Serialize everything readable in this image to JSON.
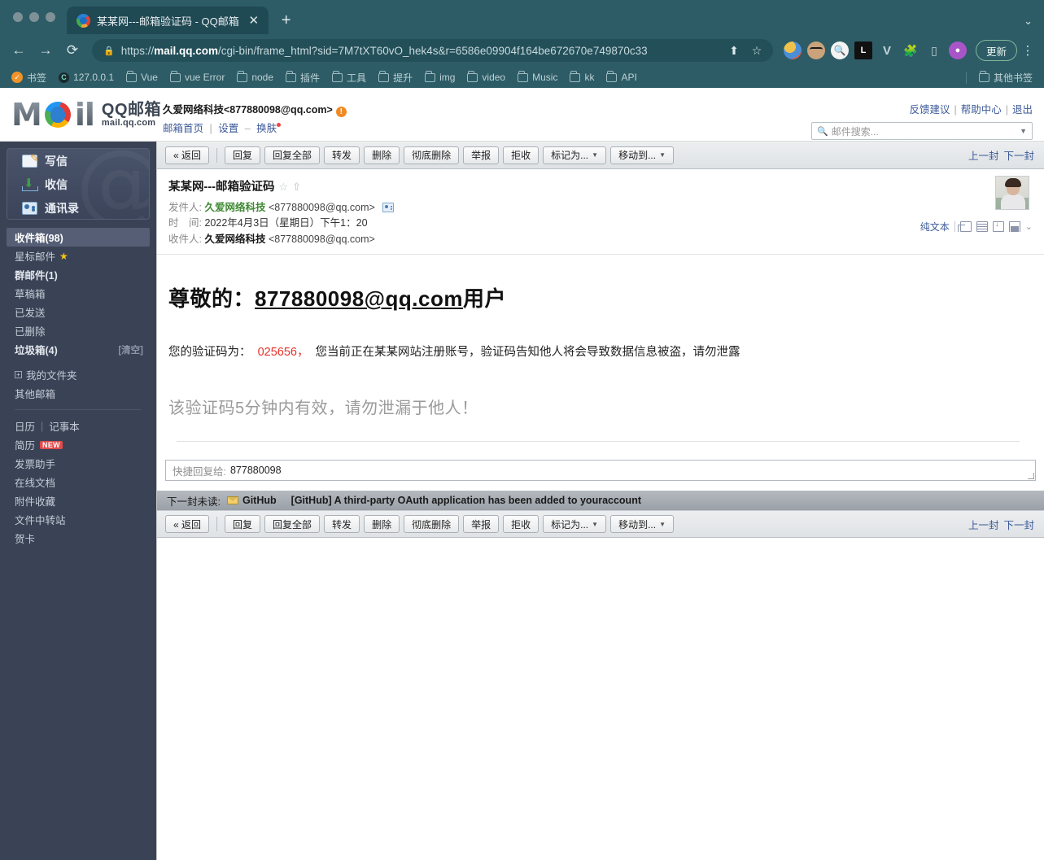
{
  "browser": {
    "tab": {
      "title": "某某网---邮箱验证码 - QQ邮箱",
      "close": "✕"
    },
    "newtab": "+",
    "window_chevron": "⌄",
    "nav": {
      "back": "←",
      "forward": "→",
      "reload": "⟳"
    },
    "omnibox": {
      "lock": "🔒",
      "url_prefix": "https://",
      "url_host": "mail.qq.com",
      "url_path": "/cgi-bin/frame_html?sid=7M7tXT60vO_hek4s&r=6586e09904f164be672670e749870c33",
      "share_icon": "⬆",
      "bookmark_icon": "☆"
    },
    "extensions": [
      "ext-a",
      "ext-b",
      "ext-c",
      "ext-d",
      "ext-e",
      "ext-f",
      "ext-g",
      "ext-h"
    ],
    "update_label": "更新",
    "menu": "⋮",
    "bookmarks": [
      {
        "label": "书签",
        "icon": "star-badge"
      },
      {
        "label": "127.0.0.1",
        "icon": "circle-c"
      },
      {
        "label": "Vue",
        "icon": "folder"
      },
      {
        "label": "vue Error",
        "icon": "folder"
      },
      {
        "label": "node",
        "icon": "folder"
      },
      {
        "label": "插件",
        "icon": "folder"
      },
      {
        "label": "工具",
        "icon": "folder"
      },
      {
        "label": "提升",
        "icon": "folder"
      },
      {
        "label": "img",
        "icon": "folder"
      },
      {
        "label": "video",
        "icon": "folder"
      },
      {
        "label": "Music",
        "icon": "folder"
      },
      {
        "label": "kk",
        "icon": "folder"
      },
      {
        "label": "API",
        "icon": "folder"
      }
    ],
    "other_bookmarks": {
      "label": "其他书签",
      "icon": "folder"
    }
  },
  "mail_header": {
    "logo": {
      "m": "M",
      "il": "il",
      "qq": "QQ邮箱",
      "url": "mail.qq.com"
    },
    "account": "久爱网络科技<877880098@qq.com>",
    "warn_badge": "!",
    "links": [
      {
        "label": "邮箱首页"
      },
      {
        "label": "设置"
      },
      {
        "label": "换肤"
      }
    ],
    "link_sep1": "|",
    "link_sep2": "–",
    "top_links": [
      {
        "label": "反馈建议"
      },
      {
        "label": "帮助中心"
      },
      {
        "label": "退出"
      }
    ],
    "top_sep": "|",
    "search": {
      "placeholder": "邮件搜索...",
      "icon": "🔍",
      "caret": "▼"
    }
  },
  "sidebar": {
    "compose": [
      {
        "label": "写信",
        "icon": "write-icon"
      },
      {
        "label": "收信",
        "icon": "receive-icon"
      },
      {
        "label": "通讯录",
        "icon": "contacts-icon"
      }
    ],
    "at_watermark": "@",
    "folders": [
      {
        "label": "收件箱(98)",
        "selected": true
      },
      {
        "label": "星标邮件",
        "star": "★"
      },
      {
        "label": "群邮件(1)",
        "bold": true
      },
      {
        "label": "草稿箱"
      },
      {
        "label": "已发送"
      },
      {
        "label": "已删除"
      },
      {
        "label": "垃圾箱(4)",
        "bold": true,
        "right": "[清空]"
      }
    ],
    "myfolder": {
      "expand": "+",
      "label": "我的文件夹"
    },
    "otherbox": {
      "label": "其他邮箱"
    },
    "tools_row": {
      "calendar": "日历",
      "sep": "|",
      "notes": "记事本"
    },
    "tools": [
      {
        "label": "简历",
        "badge": "NEW"
      },
      {
        "label": "发票助手"
      },
      {
        "label": "在线文档"
      },
      {
        "label": "附件收藏"
      },
      {
        "label": "文件中转站"
      },
      {
        "label": "贺卡"
      }
    ]
  },
  "toolbar": {
    "back": "« 返回",
    "buttons": [
      {
        "label": "回复"
      },
      {
        "label": "回复全部"
      },
      {
        "label": "转发"
      },
      {
        "label": "删除"
      },
      {
        "label": "彻底删除"
      },
      {
        "label": "举报"
      },
      {
        "label": "拒收"
      },
      {
        "label": "标记为...",
        "caret": "▼"
      },
      {
        "label": "移动到...",
        "caret": "▼"
      }
    ],
    "prev": "上一封",
    "next": "下一封"
  },
  "mail": {
    "subject": "某某网---邮箱验证码",
    "fav_star": "☆",
    "fav_up": "⇧",
    "from_label": "发件人:",
    "from_name": "久爱网络科技",
    "from_addr": "<877880098@qq.com>",
    "time_label": "时　间:",
    "time_value": "2022年4月3日（星期日）下午1：20",
    "to_label": "收件人:",
    "to_name": "久爱网络科技",
    "to_addr": "<877880098@qq.com>",
    "view_mode": "纯文本",
    "body": {
      "greet_prefix": "尊敬的：",
      "greet_link": "877880098@qq.com",
      "greet_suffix": "用户",
      "para_prefix": "您的验证码为：",
      "code": "025656，",
      "para_suffix": "您当前正在某某网站注册账号，验证码告知他人将会导致数据信息被盗，请勿泄露",
      "note": "该验证码5分钟内有效，请勿泄漏于他人！"
    }
  },
  "quick_reply": {
    "label": "快捷回复给:",
    "value": "877880098"
  },
  "next_unread": {
    "label": "下一封未读:",
    "sender": "GitHub",
    "subject": "[GitHub] A third-party OAuth application has been added to youraccount"
  }
}
